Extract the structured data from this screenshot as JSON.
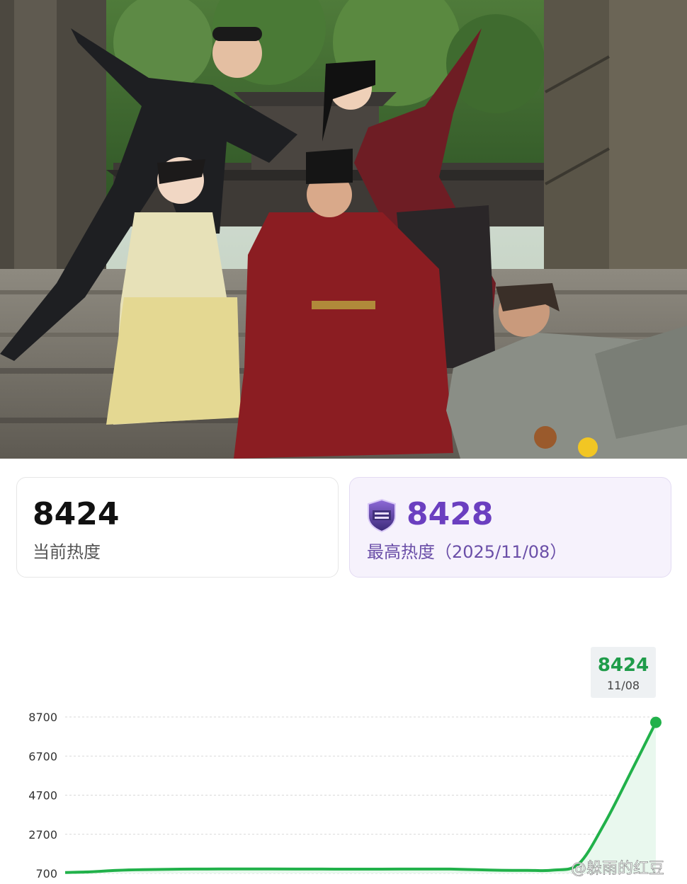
{
  "photo": {
    "description_icon": "photo-image"
  },
  "stats": {
    "current": {
      "value": "8424",
      "label": "当前热度"
    },
    "peak": {
      "value": "8428",
      "label": "最高热度（2025/11/08）",
      "badge_icon": "shield-badge-icon"
    }
  },
  "colors": {
    "line": "#21b14a",
    "fill": "#e9f8ee",
    "peak_text": "#6b3fc0",
    "tooltip_value": "#1f9c4a"
  },
  "tooltip": {
    "value": "8424",
    "date": "11/08"
  },
  "watermark": "@躲雨的红豆",
  "chart_data": {
    "type": "area",
    "title": "",
    "xlabel": "",
    "ylabel": "",
    "ylim": [
      700,
      8700
    ],
    "yticks": [
      700,
      2700,
      4700,
      6700,
      8700
    ],
    "ytick_labels": [
      "700",
      "2700",
      "4700",
      "6700",
      "8700"
    ],
    "grid": true,
    "series": [
      {
        "values": [
          748,
          780,
          852,
          890,
          910,
          920,
          924,
          925,
          924,
          922,
          920,
          918,
          916,
          920,
          922,
          920,
          890,
          860,
          854,
          868,
          1190,
          3250,
          5800,
          8424
        ]
      }
    ],
    "last_point_label": {
      "value": "8424",
      "date": "11/08"
    }
  }
}
